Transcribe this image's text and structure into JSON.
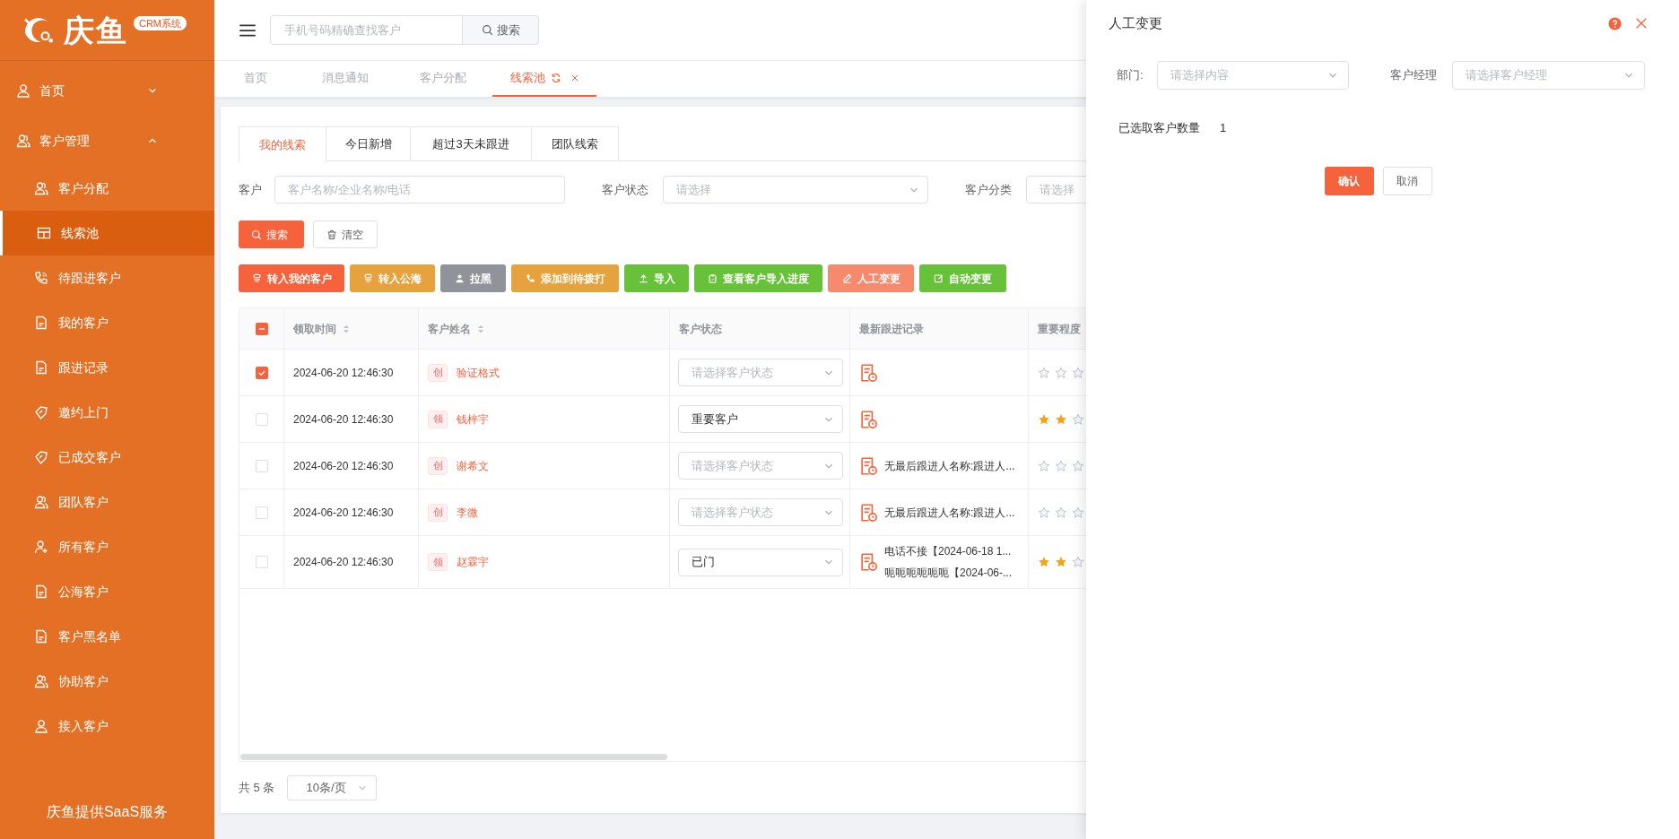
{
  "sidebar": {
    "logo": {
      "text": "庆鱼",
      "badge": "CRM系统"
    },
    "items": [
      {
        "label": "首页",
        "expanded": false
      },
      {
        "label": "客户管理",
        "expanded": true,
        "children": [
          {
            "label": "客户分配",
            "selected": false
          },
          {
            "label": "线索池",
            "selected": true
          },
          {
            "label": "待跟进客户",
            "selected": false
          },
          {
            "label": "我的客户",
            "selected": false
          },
          {
            "label": "跟进记录",
            "selected": false
          },
          {
            "label": "邀约上门",
            "selected": false
          },
          {
            "label": "已成交客户",
            "selected": false
          },
          {
            "label": "团队客户",
            "selected": false
          },
          {
            "label": "所有客户",
            "selected": false
          },
          {
            "label": "公海客户",
            "selected": false
          },
          {
            "label": "客户黑名单",
            "selected": false
          },
          {
            "label": "协助客户",
            "selected": false
          },
          {
            "label": "接入客户",
            "selected": false
          }
        ]
      }
    ],
    "footer": "庆鱼提供SaaS服务"
  },
  "header": {
    "search": {
      "placeholder": "手机号码精确查找客户"
    },
    "search_button": "搜索"
  },
  "page_tabs": [
    {
      "label": "首页",
      "selected": false
    },
    {
      "label": "消息通知",
      "selected": false
    },
    {
      "label": "客户分配",
      "selected": false
    },
    {
      "label": "线索池",
      "selected": true
    }
  ],
  "sub_tabs": [
    {
      "label": "我的线索",
      "selected": true
    },
    {
      "label": "今日新增",
      "selected": false
    },
    {
      "label": "超过3天未跟进",
      "selected": false
    },
    {
      "label": "团队线索",
      "selected": false
    }
  ],
  "filters": [
    {
      "label": "客户",
      "kind": "input",
      "placeholder": "客户名称/企业名称/电话"
    },
    {
      "label": "客户状态",
      "kind": "select",
      "placeholder": "请选择"
    },
    {
      "label": "客户分类",
      "kind": "select",
      "placeholder": "请选择"
    }
  ],
  "filter_buttons": [
    {
      "label": "搜索",
      "kind": "primary"
    },
    {
      "label": "清空",
      "kind": "plain"
    }
  ],
  "actions": [
    {
      "label": "转入我的客户",
      "color": "#f5623c",
      "kind": "transfer"
    },
    {
      "label": "转入公海",
      "color": "#e6a23c",
      "kind": "transfer"
    },
    {
      "label": "拉黑",
      "color": "#909399",
      "kind": "user"
    },
    {
      "label": "添加到待拨打",
      "color": "#e6a23c",
      "kind": "phone"
    },
    {
      "label": "导入",
      "color": "#67c23a",
      "kind": "upload"
    },
    {
      "label": "查看客户导入进度",
      "color": "#67c23a",
      "kind": "clipboard"
    },
    {
      "label": "人工变更",
      "color": "#f78a6c",
      "kind": "pen"
    },
    {
      "label": "自动变更",
      "color": "#67c23a",
      "kind": "edit"
    }
  ],
  "table": {
    "select_all": {
      "indeterminate": true
    },
    "columns": [
      {
        "label": "领取时间",
        "sortable": true
      },
      {
        "label": "客户姓名",
        "sortable": true
      },
      {
        "label": "客户状态",
        "sortable": false
      },
      {
        "label": "最新跟进记录",
        "sortable": false
      },
      {
        "label": "重要程度",
        "sortable": false
      }
    ],
    "rows": [
      {
        "checked": true,
        "time": "2024-06-20 12:46:30",
        "tag": "创",
        "name": "验证格式",
        "status": {
          "placeholder": "请选择客户状态"
        },
        "records": [],
        "stars": 0
      },
      {
        "checked": false,
        "time": "2024-06-20 12:46:30",
        "tag": "领",
        "name": "钱梓宇",
        "status": {
          "value": "重要客户"
        },
        "records": [],
        "stars": 2
      },
      {
        "checked": false,
        "time": "2024-06-20 12:46:30",
        "tag": "创",
        "name": "谢希文",
        "status": {
          "placeholder": "请选择客户状态"
        },
        "records": [
          "无最后跟进人名称:跟进人..."
        ],
        "stars": 0
      },
      {
        "checked": false,
        "time": "2024-06-20 12:46:30",
        "tag": "创",
        "name": "李微",
        "status": {
          "placeholder": "请选择客户状态"
        },
        "records": [
          "无最后跟进人名称:跟进人..."
        ],
        "stars": 0
      },
      {
        "checked": false,
        "time": "2024-06-20 12:46:30",
        "tag": "领",
        "name": "赵霖宇",
        "status": {
          "value": "已门"
        },
        "records": [
          "电话不接【2024-06-18 1...",
          "呃呃呃呃呃呃【2024-06-..."
        ],
        "stars": 2
      }
    ]
  },
  "pagination": {
    "total": "共 5 条",
    "page_size": "10条/页"
  },
  "drawer": {
    "title": "人工变更",
    "fields": [
      {
        "label": "部门:",
        "placeholder": "请选择内容"
      },
      {
        "label": "客户经理",
        "placeholder": "请选择客户经理"
      }
    ],
    "count_label": "已选取客户数量",
    "count_value": "1",
    "buttons": [
      {
        "label": "确认",
        "kind": "primary"
      },
      {
        "label": "取消",
        "kind": "plain"
      }
    ]
  }
}
